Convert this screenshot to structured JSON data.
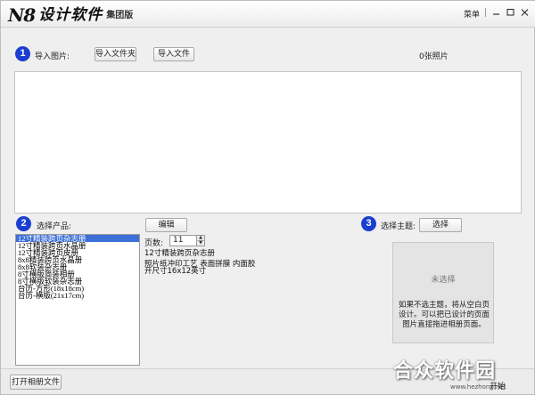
{
  "titlebar": {
    "logo_mark": "N8",
    "app_name": "设计软件",
    "edition": "集团版",
    "menu": "菜单",
    "minimize_icon": "minimize-icon",
    "maximize_icon": "maximize-icon",
    "close_icon": "close-icon"
  },
  "import": {
    "step": "1",
    "label": "导入图片:",
    "import_folder": "导入文件夹",
    "import_file": "导入文件",
    "photo_count": "0张照片"
  },
  "product": {
    "step": "2",
    "label": "选择产品:",
    "edit_button": "编辑",
    "items": [
      "12寸精装跨页杂志册",
      "12寸精装跨页水晶册",
      "12寸精装跨页皮册",
      "8x8精装跨页水晶册",
      "8x8软装杂志册",
      "8寸横版简装相册",
      "8寸横版软装杂志册",
      "台历-方形(18x18cm)",
      "台历-横版(21x17cm)"
    ],
    "selected_index": 0,
    "pages_label": "页数:",
    "pages_value": "11",
    "description_title": "12寸精装跨页杂志册",
    "description_lines": [
      "照片纸冲印工艺 表面拼膜 内面胶",
      "开尺寸16x12英寸"
    ]
  },
  "theme": {
    "step": "3",
    "label": "选择主题:",
    "select_button": "选择",
    "empty_text": "未选择",
    "hint": "如果不选主题，将从空白页设计。可以把已设计的页面图片直接拖进相册页面。"
  },
  "bottom": {
    "open_album_file": "打开相册文件",
    "start": "开始"
  },
  "watermark": {
    "text": "合众软件园",
    "url": "www.hezhong.net"
  },
  "colors": {
    "step_circle": "#1a3fd0",
    "selection": "#3c6fd8"
  }
}
